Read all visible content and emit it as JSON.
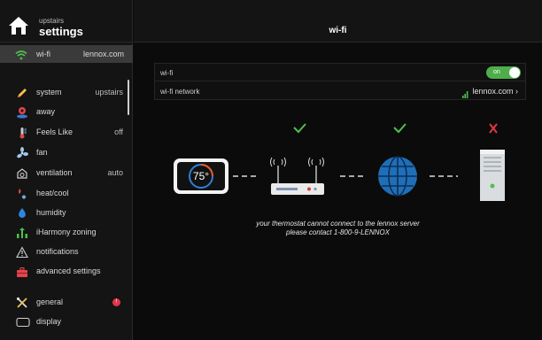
{
  "brand": {
    "subtitle": "upstairs",
    "title": "settings"
  },
  "main": {
    "title": "wi-fi"
  },
  "sidebar": {
    "wifi": {
      "label": "wi-fi",
      "value": "lennox.com"
    },
    "items": [
      {
        "label": "system",
        "value": "upstairs",
        "icon": "pencil-icon"
      },
      {
        "label": "away",
        "value": "",
        "icon": "away-pin-icon"
      },
      {
        "label": "Feels Like",
        "value": "off",
        "icon": "thermometer-icon"
      },
      {
        "label": "fan",
        "value": "",
        "icon": "fan-icon"
      },
      {
        "label": "ventilation",
        "value": "auto",
        "icon": "ventilation-icon"
      },
      {
        "label": "heat/cool",
        "value": "",
        "icon": "heat-cool-icon"
      },
      {
        "label": "humidity",
        "value": "",
        "icon": "humidity-drop-icon"
      },
      {
        "label": "iHarmony zoning",
        "value": "",
        "icon": "zoning-icon"
      },
      {
        "label": "notifications",
        "value": "",
        "icon": "warning-triangle-icon"
      },
      {
        "label": "advanced settings",
        "value": "",
        "icon": "toolbox-icon"
      },
      {
        "label": "general",
        "value": "",
        "icon": "tools-icon",
        "badge": "!"
      },
      {
        "label": "display",
        "value": "",
        "icon": "display-icon"
      }
    ]
  },
  "settings": {
    "wifi_label": "wi-fi",
    "toggle_text": "on",
    "toggle_on": true,
    "network_label": "wi-fi network",
    "network_value": "lennox.com"
  },
  "diagram": {
    "thermostat_temp": "75°",
    "status_1": "ok",
    "status_2": "ok",
    "status_3": "failed",
    "ok_color": "#4fbf4f",
    "fail_color": "#e2383f"
  },
  "message": {
    "line1": "your thermostat cannot connect to the lennox server",
    "line2": "please contact 1-800-9-LENNOX"
  },
  "colors": {
    "accent_green": "#4dae4a",
    "badge_red": "#e0364a",
    "globe_blue": "#1f6fb8"
  }
}
